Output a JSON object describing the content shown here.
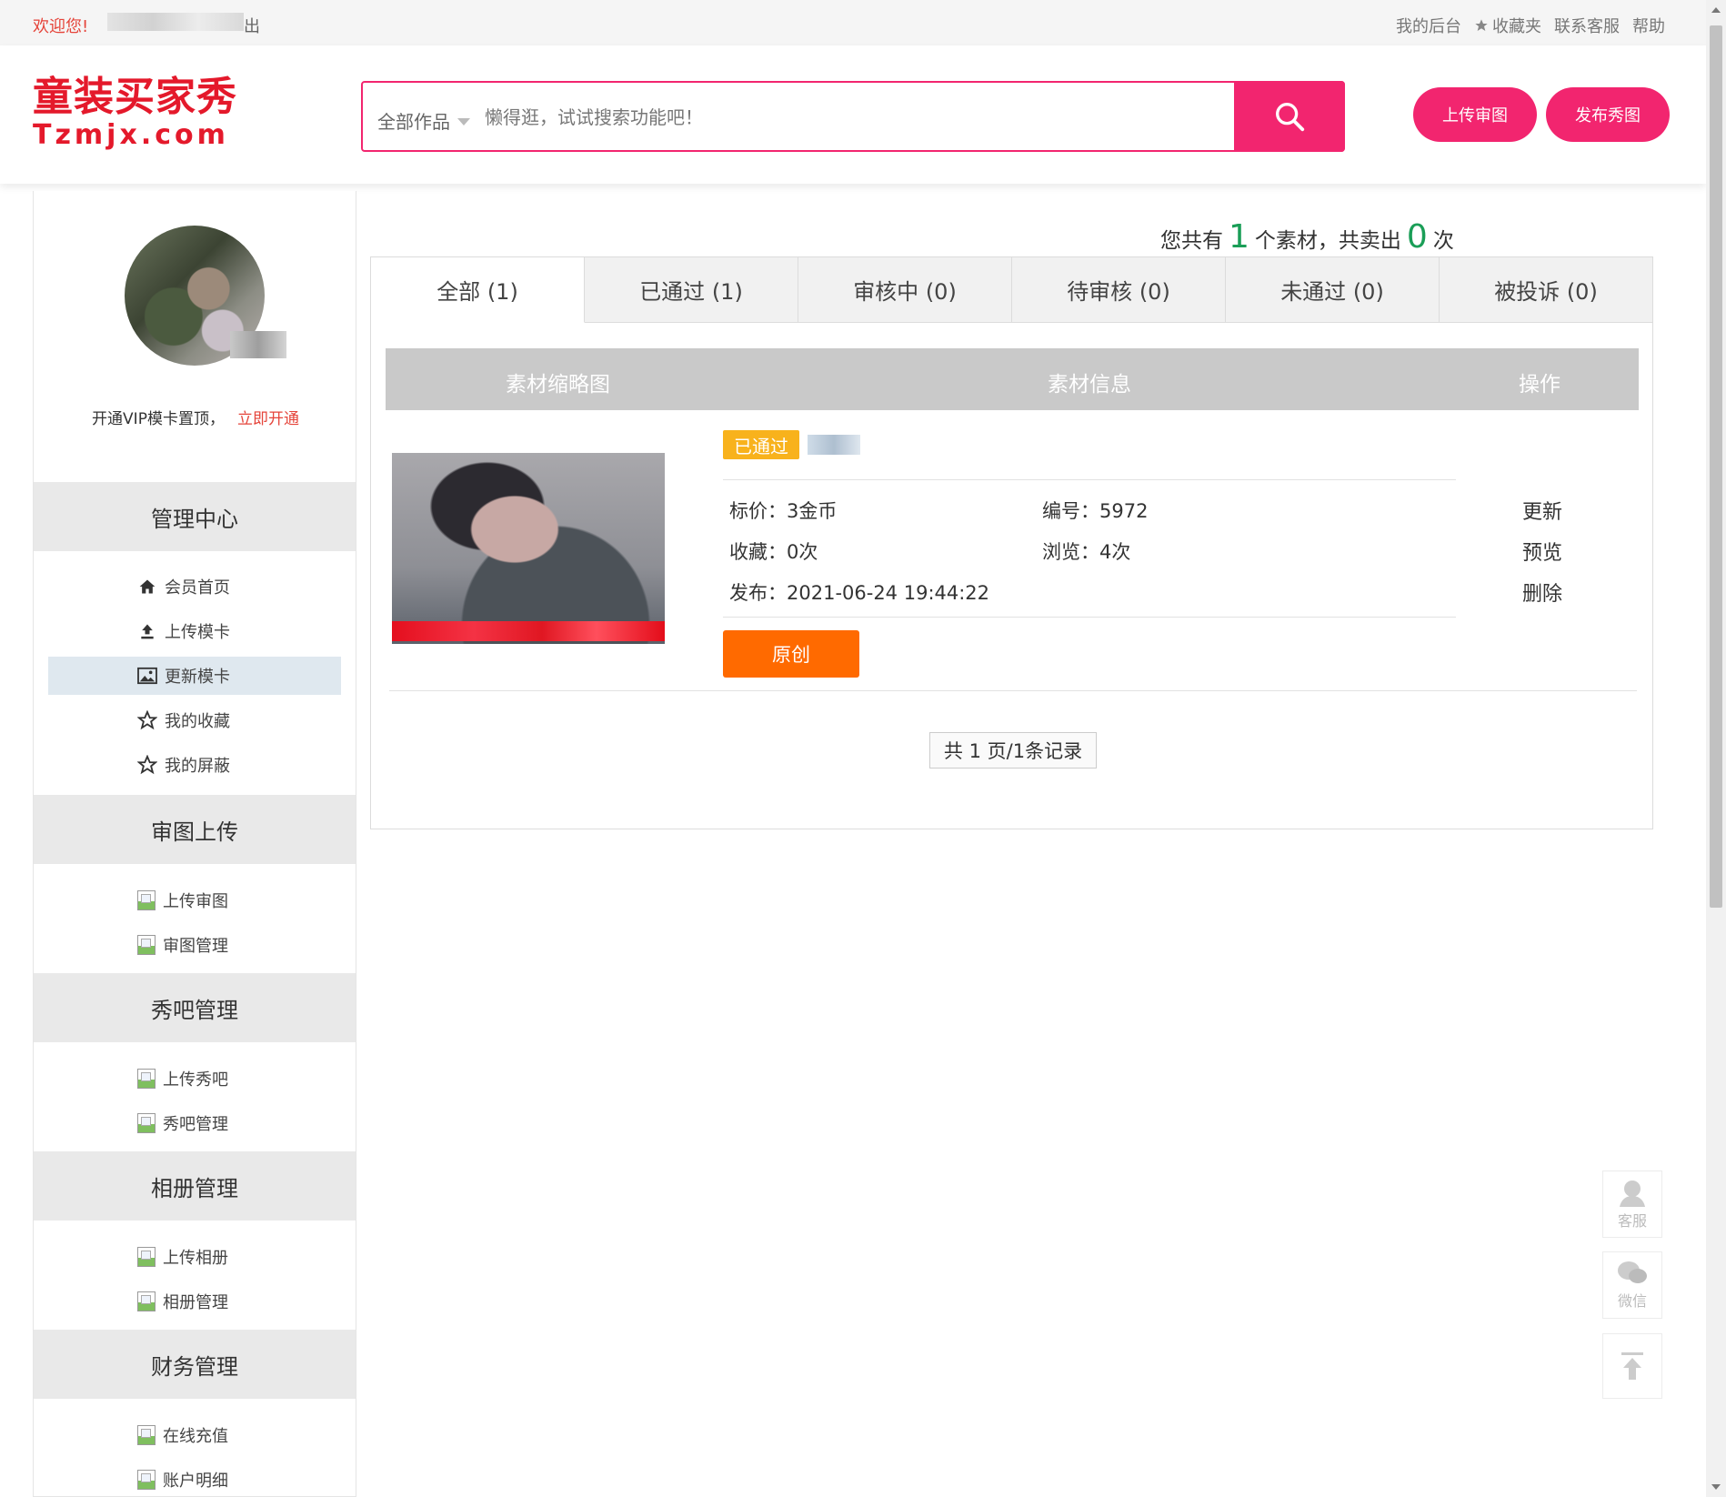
{
  "topbar": {
    "welcome": "欢迎您!",
    "logout": "出",
    "links": {
      "backend": "我的后台",
      "favorites": "收藏夹",
      "service": "联系客服",
      "help": "帮助"
    }
  },
  "header": {
    "logo_cn": "童装买家秀",
    "logo_en": "Tzmjx.com",
    "search": {
      "category": "全部作品",
      "placeholder": "懒得逛，试试搜索功能吧！"
    },
    "upload_review_label": "上传审图",
    "publish_show_label": "发布秀图",
    "brand_color": "#f2256f"
  },
  "sidebar": {
    "vip_text": "开通VIP模卡置顶，",
    "vip_link": "立即开通",
    "sections": [
      {
        "title": "管理中心",
        "items": [
          {
            "label": "会员首页",
            "icon": "home-icon"
          },
          {
            "label": "上传模卡",
            "icon": "upload-icon"
          },
          {
            "label": "更新模卡",
            "icon": "image-icon",
            "active": true
          },
          {
            "label": "我的收藏",
            "icon": "star-icon"
          },
          {
            "label": "我的屏蔽",
            "icon": "star-icon"
          }
        ]
      },
      {
        "title": "审图上传",
        "items": [
          {
            "label": "上传审图"
          },
          {
            "label": "审图管理"
          }
        ]
      },
      {
        "title": "秀吧管理",
        "items": [
          {
            "label": "上传秀吧"
          },
          {
            "label": "秀吧管理"
          }
        ]
      },
      {
        "title": "相册管理",
        "items": [
          {
            "label": "上传相册"
          },
          {
            "label": "相册管理"
          }
        ]
      },
      {
        "title": "财务管理",
        "items": [
          {
            "label": "在线充值"
          },
          {
            "label": "账户明细"
          }
        ]
      }
    ]
  },
  "summary": {
    "prefix": "您共有",
    "materials": "1",
    "middle": "个素材，共卖出",
    "sold": "0",
    "suffix": "次"
  },
  "tabs": [
    "全部 (1)",
    "已通过 (1)",
    "审核中 (0)",
    "待审核 (0)",
    "未通过 (0)",
    "被投诉 (0)"
  ],
  "table": {
    "headers": [
      "素材缩略图",
      "素材信息",
      "操作"
    ],
    "row": {
      "status": "已通过",
      "price": "标价：3金币",
      "number": "编号：5972",
      "collect": "收藏：0次",
      "views": "浏览：4次",
      "published": "发布：2021-06-24 19:44:22",
      "original_label": "原创",
      "actions": [
        "更新",
        "预览",
        "删除"
      ]
    }
  },
  "pager": "共 1 页/1条记录",
  "float": {
    "service": "客服",
    "wechat": "微信"
  }
}
